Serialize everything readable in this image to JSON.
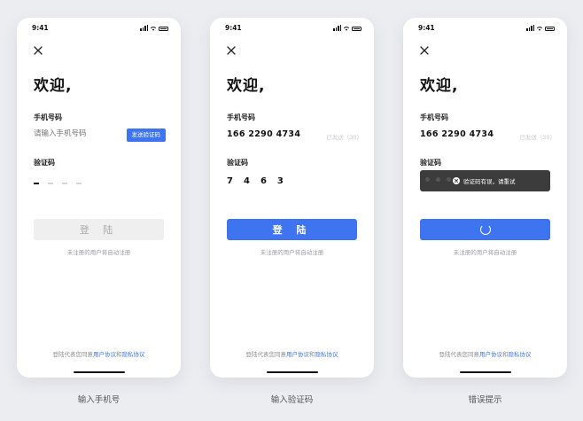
{
  "status_bar": {
    "time": "9:41"
  },
  "welcome_title": "欢迎,",
  "labels": {
    "phone": "手机号码",
    "code": "验证码"
  },
  "screen1": {
    "phone_placeholder": "请输入手机号码",
    "send_code_button": "发送验证码",
    "login_button": "登 陆",
    "caption": "输入手机号"
  },
  "screen2": {
    "phone_value": "166 2290 4734",
    "resend_text": "已发送（30）",
    "code_digits": [
      "7",
      "4",
      "6",
      "3"
    ],
    "login_button": "登 陆",
    "caption": "输入验证码"
  },
  "screen3": {
    "phone_value": "166 2290 4734",
    "resend_text": "已发送（30）",
    "toast_text": "验证码有误，请重试",
    "caption": "错误提示"
  },
  "hint_text": "未注册的用户将自动注册",
  "agreement": {
    "prefix": "登陆代表您同意",
    "user_agreement": "用户协议",
    "and": "和",
    "privacy_agreement": "隐私协议"
  },
  "colors": {
    "accent": "#3f74f1",
    "toast_bg": "#3c3c3c",
    "background": "#ecedf1"
  },
  "icons": [
    "close-icon",
    "signal-icon",
    "wifi-icon",
    "battery-icon",
    "error-icon",
    "loading-spinner-icon"
  ]
}
